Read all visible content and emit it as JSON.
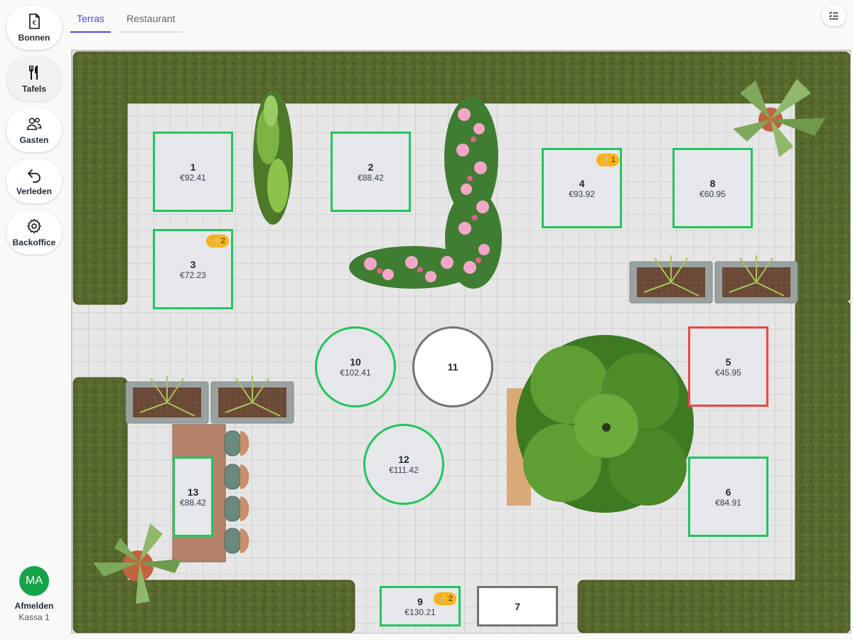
{
  "sidebar": {
    "items": [
      {
        "label": "Bonnen",
        "icon": "receipt-euro-icon"
      },
      {
        "label": "Tafels",
        "icon": "cutlery-icon"
      },
      {
        "label": "Gasten",
        "icon": "users-icon"
      },
      {
        "label": "Verleden",
        "icon": "undo-arrow-icon"
      },
      {
        "label": "Backoffice",
        "icon": "gear-icon"
      }
    ],
    "active": "Tafels",
    "user": {
      "initials": "MA",
      "logout_label": "Afmelden",
      "register": "Kassa 1"
    }
  },
  "tabs": [
    {
      "label": "Terras",
      "active": true
    },
    {
      "label": "Restaurant",
      "active": false
    }
  ],
  "toolbar": {
    "list_view_icon": "list-view-icon"
  },
  "floor": {
    "tables": [
      {
        "number": "1",
        "amount": "€92.41",
        "status": "occupied"
      },
      {
        "number": "2",
        "amount": "€88.42",
        "status": "occupied"
      },
      {
        "number": "3",
        "amount": "€72.23",
        "status": "occupied",
        "badge": "2"
      },
      {
        "number": "4",
        "amount": "€93.92",
        "status": "occupied",
        "badge": "1"
      },
      {
        "number": "8",
        "amount": "€60.95",
        "status": "occupied"
      },
      {
        "number": "10",
        "amount": "€102.41",
        "status": "occupied"
      },
      {
        "number": "11",
        "amount": "",
        "status": "free"
      },
      {
        "number": "5",
        "amount": "€45.95",
        "status": "alert"
      },
      {
        "number": "12",
        "amount": "€111.42",
        "status": "occupied"
      },
      {
        "number": "6",
        "amount": "€84.91",
        "status": "occupied"
      },
      {
        "number": "13",
        "amount": "€88.42",
        "status": "occupied"
      },
      {
        "number": "9",
        "amount": "€130.21",
        "status": "occupied",
        "badge": "2"
      },
      {
        "number": "7",
        "amount": "",
        "status": "free"
      }
    ],
    "colors": {
      "occupied": "#22c55e",
      "alert": "#ef4444",
      "free": "#78716c",
      "badge": "#f8b31a",
      "hedge": "#556b2f",
      "accent": "#4f46e5"
    }
  }
}
